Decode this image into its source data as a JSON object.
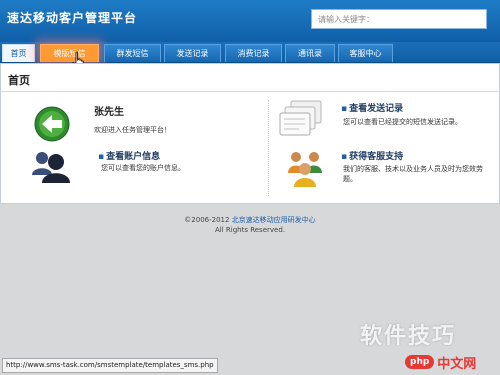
{
  "header": {
    "brand": "速达移动客户管理平台",
    "search_placeholder": "请输入关键字："
  },
  "nav": {
    "tabs": [
      "首页",
      "模版短信",
      "群发短信",
      "发送记录",
      "消费记录",
      "通讯录",
      "客服中心"
    ],
    "active_index": 0,
    "hover_index": 1
  },
  "main": {
    "title": "首页",
    "welcome": {
      "name": "张先生",
      "text": "欢迎进入任务管理平台！"
    },
    "account": {
      "title": "查看账户信息",
      "desc": "您可以查看您的账户信息。"
    },
    "records": {
      "title": "查看发送记录",
      "desc": "您可以查看已经提交的短信发送记录。"
    },
    "support": {
      "title": "获得客服支持",
      "desc_line1": "我们的客服、技术以及业务人员及时为您效劳",
      "desc_line2": "题。"
    }
  },
  "footer": {
    "copyright": "©2006-2012",
    "company": "北京速达移动应用研发中心",
    "rights": "All Rights Reserved."
  },
  "statusbar": {
    "url": "http://www.sms-task.com/smstemplate/templates_sms.php"
  },
  "watermark": {
    "text": "软件技巧",
    "logo_php": "php",
    "logo_cn": "中文网"
  },
  "colors": {
    "header": "#1a6fb8",
    "hover_tab": "#ff9933",
    "link": "#1f5fa8"
  }
}
